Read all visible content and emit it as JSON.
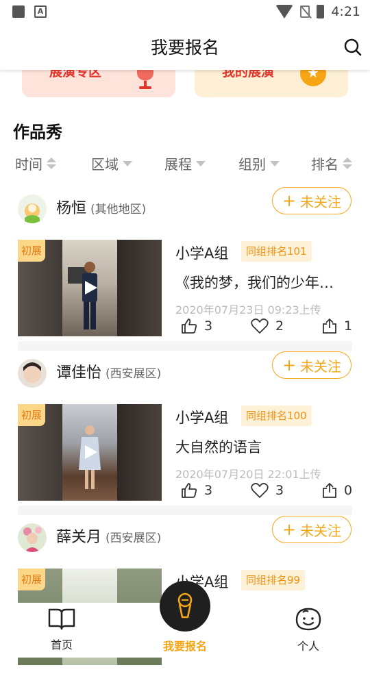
{
  "status_bar": {
    "time": "4:21"
  },
  "header": {
    "title": "我要报名"
  },
  "promos": [
    {
      "label": "展演专区",
      "color": "#fde3d9"
    },
    {
      "label": "我的展演",
      "color": "#fdefd3"
    }
  ],
  "section_title": "作品秀",
  "filters": [
    {
      "label": "时间",
      "icon": "sort-icon"
    },
    {
      "label": "区域",
      "icon": "dropdown-icon"
    },
    {
      "label": "展程",
      "icon": "dropdown-icon"
    },
    {
      "label": "组别",
      "icon": "dropdown-icon"
    },
    {
      "label": "排名",
      "icon": "sort-icon"
    }
  ],
  "follow_label": "未关注",
  "entries": [
    {
      "name": "杨恒",
      "region": "(其他地区)",
      "badge": "初展",
      "group": "小学A组",
      "rank": "同组排名101",
      "title": "《我的梦，我们的少年…",
      "uploaded": "2020年07月23日 09:23上传",
      "likes": "3",
      "favorites": "2",
      "shares": "1"
    },
    {
      "name": "谭佳怡",
      "region": "(西安展区)",
      "badge": "初展",
      "group": "小学A组",
      "rank": "同组排名100",
      "title": "大自然的语言",
      "uploaded": "2020年07月20日 22:01上传",
      "likes": "3",
      "favorites": "3",
      "shares": "0"
    },
    {
      "name": "薛关月",
      "region": "(西安展区)",
      "badge": "初展",
      "group": "小学A组",
      "rank": "同组排名99"
    }
  ],
  "tabs": [
    {
      "label": "首页",
      "icon": "book-icon"
    },
    {
      "label": "我要报名",
      "icon": "microphone-icon",
      "active": true
    },
    {
      "label": "个人",
      "icon": "smiley-icon"
    }
  ],
  "colors": {
    "accent": "#f6a515",
    "badge_bg": "#fbd889",
    "rank_bg": "#fdf1d8"
  }
}
